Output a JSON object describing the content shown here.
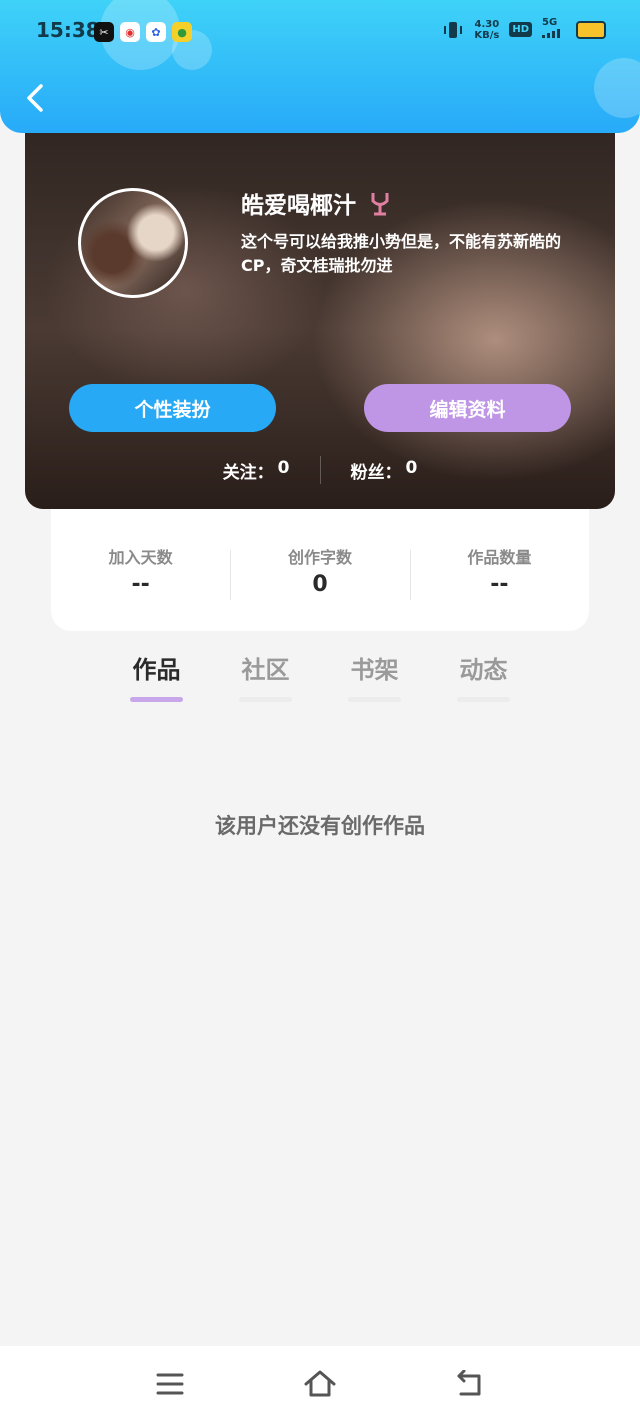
{
  "status_bar": {
    "time": "15:38",
    "net_speed_value": "4.30",
    "net_speed_unit": "KB/s",
    "hd_label": "HD",
    "network_label": "5G",
    "battery_color": "#f7c22a"
  },
  "header": {
    "background_colors": [
      "#3fd2f8",
      "#27aaf8"
    ]
  },
  "profile": {
    "username": "皓爱喝椰汁",
    "bio": "这个号可以给我推小势但是，不能有苏新皓的CP，奇文桂瑞批勿进",
    "dress_button_label": "个性装扮",
    "edit_button_label": "编辑资料",
    "following": {
      "label": "关注：",
      "value": "0"
    },
    "followers": {
      "label": "粉丝：",
      "value": "0"
    }
  },
  "stats": [
    {
      "label": "加入天数",
      "value": "--"
    },
    {
      "label": "创作字数",
      "value": "0"
    },
    {
      "label": "作品数量",
      "value": "--"
    }
  ],
  "tabs": [
    {
      "label": "作品",
      "active": true
    },
    {
      "label": "社区",
      "active": false
    },
    {
      "label": "书架",
      "active": false
    },
    {
      "label": "动态",
      "active": false
    }
  ],
  "empty_state": {
    "text": "该用户还没有创作作品"
  },
  "colors": {
    "accent_blue": "#27a9f6",
    "accent_purple": "#bf95e6",
    "tab_active_underline": "#c8a6ea"
  }
}
